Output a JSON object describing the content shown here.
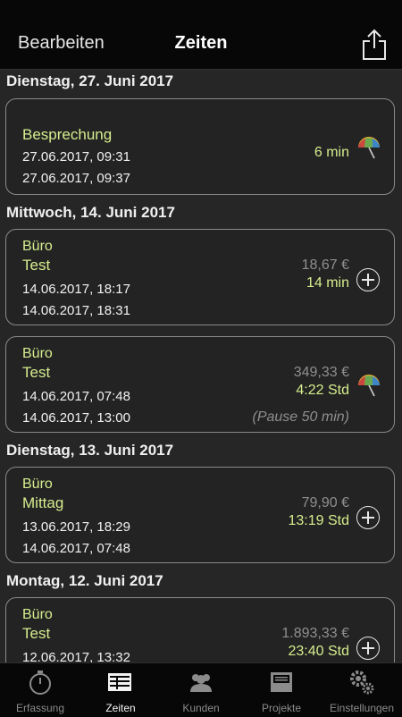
{
  "navbar": {
    "edit_label": "Bearbeiten",
    "title": "Zeiten",
    "share_icon": "share-icon"
  },
  "sections": [
    {
      "header": "Dienstag, 27. Juni 2017",
      "entries": [
        {
          "category": "",
          "description": "Besprechung",
          "start": "27.06.2017, 09:31",
          "end": "27.06.2017, 09:37",
          "amount": "",
          "duration": "6 min",
          "pause": "",
          "action_icon": "umbrella-icon"
        }
      ]
    },
    {
      "header": "Mittwoch, 14. Juni 2017",
      "entries": [
        {
          "category": "Büro",
          "description": "Test",
          "start": "14.06.2017, 18:17",
          "end": "14.06.2017, 18:31",
          "amount": "18,67 €",
          "duration": "14 min",
          "pause": "",
          "action_icon": "plus-circle-icon"
        },
        {
          "category": "Büro",
          "description": "Test",
          "start": "14.06.2017, 07:48",
          "end": "14.06.2017, 13:00",
          "amount": "349,33 €",
          "duration": "4:22 Std",
          "pause": "(Pause 50 min)",
          "action_icon": "umbrella-icon"
        }
      ]
    },
    {
      "header": "Dienstag, 13. Juni 2017",
      "entries": [
        {
          "category": "Büro",
          "description": "Mittag",
          "start": "13.06.2017, 18:29",
          "end": "14.06.2017, 07:48",
          "amount": "79,90 €",
          "duration": "13:19 Std",
          "pause": "",
          "action_icon": "plus-circle-icon"
        }
      ]
    },
    {
      "header": "Montag, 12. Juni 2017",
      "entries": [
        {
          "category": "Büro",
          "description": "Test",
          "start": "12.06.2017, 13:32",
          "end": "",
          "amount": "1.893,33 €",
          "duration": "23:40 Std",
          "pause": "",
          "action_icon": "plus-circle-icon"
        }
      ]
    }
  ],
  "tabbar": {
    "tabs": [
      {
        "label": "Erfassung",
        "icon": "stopwatch-icon",
        "active": false
      },
      {
        "label": "Zeiten",
        "icon": "list-icon",
        "active": true
      },
      {
        "label": "Kunden",
        "icon": "people-icon",
        "active": false
      },
      {
        "label": "Projekte",
        "icon": "inbox-icon",
        "active": false
      },
      {
        "label": "Einstellungen",
        "icon": "gears-icon",
        "active": false
      }
    ]
  },
  "colors": {
    "accent_green": "#d6ed8e",
    "background": "#262626",
    "bar_background": "#070707"
  }
}
